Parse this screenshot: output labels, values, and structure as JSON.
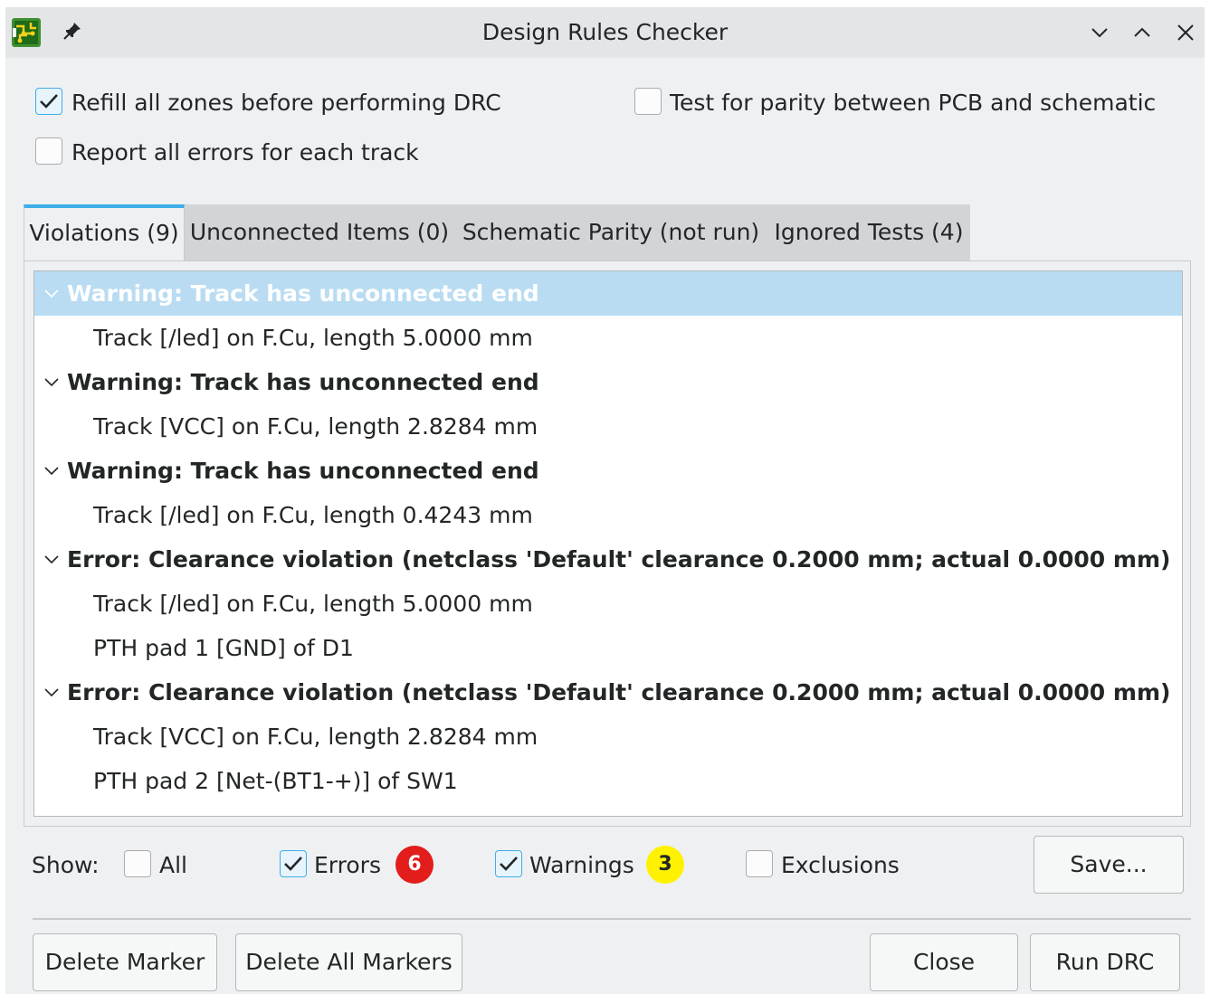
{
  "window": {
    "title": "Design Rules Checker",
    "app_icon": "pcbnew-icon",
    "controls": [
      "pin-icon",
      "minimize-icon",
      "maximize-icon",
      "close-icon"
    ]
  },
  "options": {
    "refill_zones": {
      "label": "Refill all zones before performing DRC",
      "checked": true
    },
    "report_all_errors": {
      "label": "Report all errors for each track",
      "checked": false
    },
    "test_parity": {
      "label": "Test for parity between PCB and schematic",
      "checked": false
    }
  },
  "tabs": [
    {
      "label": "Violations (9)",
      "active": true
    },
    {
      "label": "Unconnected Items (0)",
      "active": false
    },
    {
      "label": "Schematic Parity (not run)",
      "active": false
    },
    {
      "label": "Ignored Tests (4)",
      "active": false
    }
  ],
  "violations": [
    {
      "title": "Warning: Track has unconnected end",
      "selected": true,
      "items": [
        "Track [/led] on F.Cu, length 5.0000 mm"
      ]
    },
    {
      "title": "Warning: Track has unconnected end",
      "selected": false,
      "items": [
        "Track [VCC] on F.Cu, length 2.8284 mm"
      ]
    },
    {
      "title": "Warning: Track has unconnected end",
      "selected": false,
      "items": [
        "Track [/led] on F.Cu, length 0.4243 mm"
      ]
    },
    {
      "title": "Error: Clearance violation (netclass 'Default' clearance 0.2000 mm; actual 0.0000 mm)",
      "selected": false,
      "items": [
        "Track [/led] on F.Cu, length 5.0000 mm",
        "PTH pad 1 [GND] of D1"
      ]
    },
    {
      "title": "Error: Clearance violation (netclass 'Default' clearance 0.2000 mm; actual 0.0000 mm)",
      "selected": false,
      "items": [
        "Track [VCC] on F.Cu, length 2.8284 mm",
        "PTH pad 2 [Net-(BT1-+)] of SW1"
      ]
    }
  ],
  "filters": {
    "show_label": "Show:",
    "all": {
      "label": "All",
      "checked": false
    },
    "errors": {
      "label": "Errors",
      "checked": true,
      "count": "6",
      "badge_color": "#e31c1c"
    },
    "warnings": {
      "label": "Warnings",
      "checked": true,
      "count": "3",
      "badge_color": "#fff200"
    },
    "exclusions": {
      "label": "Exclusions",
      "checked": false
    }
  },
  "buttons": {
    "save": "Save...",
    "delete_marker": "Delete Marker",
    "delete_all_markers": "Delete All Markers",
    "close": "Close",
    "run_drc": "Run DRC"
  },
  "colors": {
    "accent": "#3daee9",
    "selection": "#b9dcf2"
  }
}
